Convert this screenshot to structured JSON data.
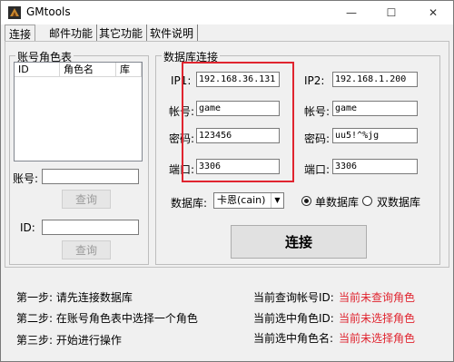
{
  "window": {
    "title": "GMtools",
    "minimize": "—",
    "maximize": "☐",
    "close": "✕"
  },
  "tabs": [
    {
      "label": "连接"
    },
    {
      "label": "邮件功能"
    },
    {
      "label": "其它功能"
    },
    {
      "label": "软件说明"
    }
  ],
  "account_group": {
    "title": "账号角色表",
    "columns": [
      "ID",
      "角色名",
      "库"
    ],
    "account_label": "账号:",
    "account_value": "",
    "query_button_1": "查询",
    "id_label": "ID:",
    "id_value": "",
    "query_button_2": "查询"
  },
  "db_group": {
    "title": "数据库连接",
    "ip1_label": "IP1:",
    "ip1_value": "192.168.36.131",
    "user1_label": "帐号:",
    "user1_value": "game",
    "pwd1_label": "密码:",
    "pwd1_value": "123456",
    "port1_label": "端口:",
    "port1_value": "3306",
    "ip2_label": "IP2:",
    "ip2_value": "192.168.1.200",
    "user2_label": "帐号:",
    "user2_value": "game",
    "pwd2_label": "密码:",
    "pwd2_value": "uu5!^%jg",
    "port2_label": "端口:",
    "port2_value": "3306",
    "dbtype_label": "数据库:",
    "dbtype_selected": "卡恩(cain)",
    "radio_single": "单数据库",
    "radio_double": "双数据库",
    "connect_button": "连接"
  },
  "steps": {
    "step1": "第一步: 请先连接数据库",
    "step2": "第二步: 在账号角色表中选择一个角色",
    "step3": "第三步: 开始进行操作"
  },
  "status": {
    "account_label": "当前查询帐号ID:",
    "account_value": "当前未查询角色",
    "role_id_label": "当前选中角色ID:",
    "role_id_value": "当前未选择角色",
    "role_name_label": "当前选中角色名:",
    "role_name_value": "当前未选择角色"
  },
  "colors": {
    "accent_red": "#e0242f"
  }
}
